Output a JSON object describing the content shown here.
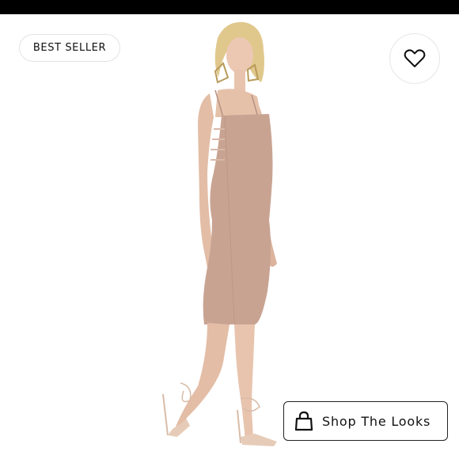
{
  "badge": {
    "label": "BEST SELLER"
  },
  "favorite": {
    "icon": "heart-icon"
  },
  "cta": {
    "label": "Shop The Looks",
    "icon": "shopping-bag-icon"
  },
  "colors": {
    "dress": "#c9a493",
    "skin": "#e6c2ad",
    "hair": "#e3cc93",
    "top_bar": "#000000"
  }
}
